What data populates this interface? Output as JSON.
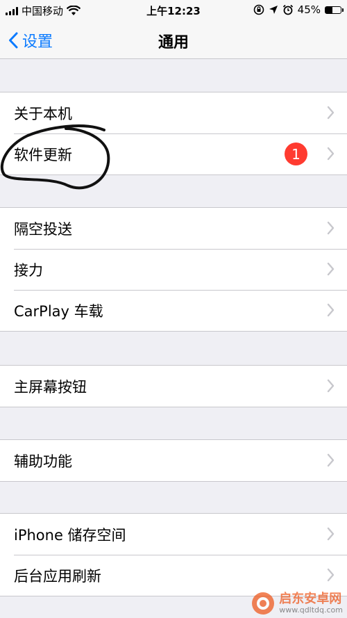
{
  "status_bar": {
    "carrier": "中国移动",
    "time": "上午12:23",
    "battery_percent": "45%",
    "battery_level": 0.45,
    "icons": [
      "signal-icon",
      "wifi-icon",
      "orientation-lock-icon",
      "location-icon",
      "alarm-icon",
      "battery-icon"
    ]
  },
  "nav": {
    "back_label": "设置",
    "title": "通用"
  },
  "groups": [
    {
      "items": [
        {
          "label": "关于本机"
        },
        {
          "label": "软件更新",
          "badge": "1"
        }
      ]
    },
    {
      "items": [
        {
          "label": "隔空投送"
        },
        {
          "label": "接力"
        },
        {
          "label": "CarPlay 车载"
        }
      ]
    },
    {
      "items": [
        {
          "label": "主屏幕按钮"
        }
      ]
    },
    {
      "items": [
        {
          "label": "辅助功能"
        }
      ]
    },
    {
      "items": [
        {
          "label": "iPhone 储存空间"
        },
        {
          "label": "后台应用刷新"
        }
      ]
    }
  ],
  "watermark": {
    "title": "启东安卓网",
    "url": "www.qdltdq.com"
  },
  "colors": {
    "accent": "#0a7aff",
    "badge": "#ff3b30",
    "background": "#efeff4",
    "separator": "#c8c7cc",
    "chevron": "#c7c7cc"
  }
}
